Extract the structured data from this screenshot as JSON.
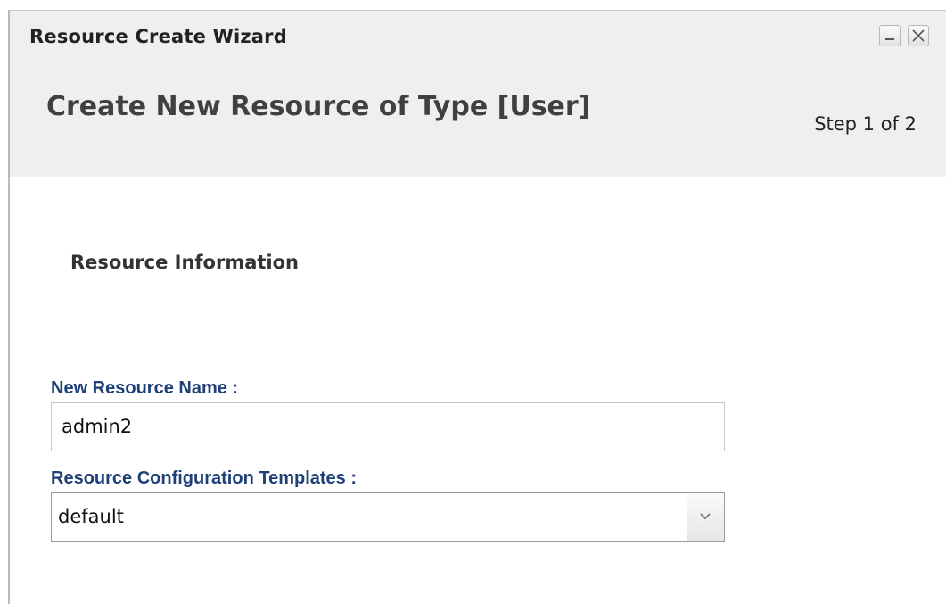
{
  "window": {
    "title": "Resource Create Wizard"
  },
  "header": {
    "heading": "Create New Resource of Type [User]",
    "step": "Step 1 of 2"
  },
  "section": {
    "title": "Resource Information"
  },
  "form": {
    "name_label": "New Resource Name :",
    "name_value": "admin2",
    "templates_label": "Resource Configuration Templates :",
    "templates_selected": "default"
  },
  "icons": {
    "minimize": "minimize-icon",
    "close": "close-icon",
    "dropdown": "chevron-down-icon"
  },
  "colors": {
    "label": "#1f3f78",
    "header_bg": "#efefef"
  }
}
